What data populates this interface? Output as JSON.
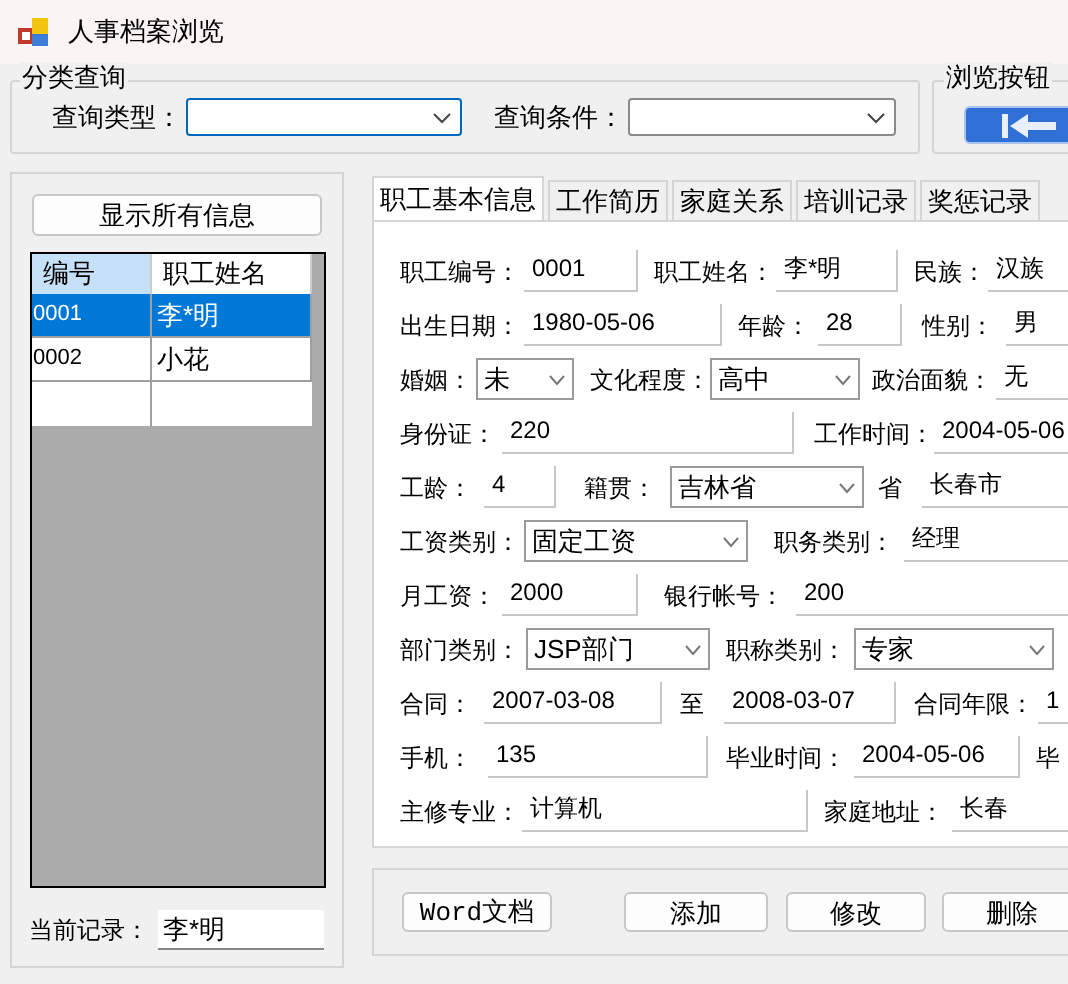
{
  "window": {
    "title": "人事档案浏览"
  },
  "query_group": {
    "title": "分类查询",
    "fields": [
      {
        "label": "查询类型：",
        "focused": true
      },
      {
        "label": "查询条件：",
        "focused": false
      }
    ]
  },
  "browse_group": {
    "title": "浏览按钮"
  },
  "show_all_button": "显示所有信息",
  "employee_grid": {
    "columns": [
      {
        "label": "编号",
        "highlighted": true
      },
      {
        "label": "职工姓名",
        "highlighted": false
      }
    ],
    "rows": [
      {
        "cells": [
          "0001",
          "李*明"
        ],
        "selected": true
      },
      {
        "cells": [
          "0002",
          "小花"
        ],
        "selected": false
      }
    ]
  },
  "current_record": {
    "label": "当前记录：",
    "value": "李*明"
  },
  "tabs": [
    {
      "label": "职工基本信息",
      "selected": true
    },
    {
      "label": "工作简历",
      "selected": false
    },
    {
      "label": "家庭关系",
      "selected": false
    },
    {
      "label": "培训记录",
      "selected": false
    },
    {
      "label": "奖惩记录",
      "selected": false
    }
  ],
  "form_rows": [
    [
      {
        "kind": "label",
        "text": "职工编号："
      },
      {
        "kind": "text",
        "value": "0001"
      },
      {
        "kind": "label",
        "text": "职工姓名："
      },
      {
        "kind": "text",
        "value": "李*明"
      },
      {
        "kind": "label",
        "text": "民族："
      },
      {
        "kind": "text",
        "value": "汉族"
      }
    ],
    [
      {
        "kind": "label",
        "text": "出生日期："
      },
      {
        "kind": "text",
        "value": "1980-05-06"
      },
      {
        "kind": "label",
        "text": "年龄："
      },
      {
        "kind": "text",
        "value": "28"
      },
      {
        "kind": "label",
        "text": "性别："
      },
      {
        "kind": "text",
        "value": "男"
      }
    ],
    [
      {
        "kind": "label",
        "text": "婚姻："
      },
      {
        "kind": "combo",
        "value": "未"
      },
      {
        "kind": "label",
        "text": "文化程度："
      },
      {
        "kind": "combo",
        "value": "高中"
      },
      {
        "kind": "label",
        "text": "政治面貌："
      },
      {
        "kind": "text",
        "value": "无"
      }
    ],
    [
      {
        "kind": "label",
        "text": "身份证："
      },
      {
        "kind": "text",
        "value": "220"
      },
      {
        "kind": "label",
        "text": "工作时间："
      },
      {
        "kind": "text",
        "value": "2004-05-06"
      }
    ],
    [
      {
        "kind": "label",
        "text": "工龄："
      },
      {
        "kind": "text",
        "value": "4"
      },
      {
        "kind": "label",
        "text": "籍贯："
      },
      {
        "kind": "combo",
        "value": "吉林省"
      },
      {
        "kind": "label",
        "text": "省"
      },
      {
        "kind": "text",
        "value": "长春市"
      }
    ],
    [
      {
        "kind": "label",
        "text": "工资类别："
      },
      {
        "kind": "combo",
        "value": "固定工资"
      },
      {
        "kind": "label",
        "text": "职务类别："
      },
      {
        "kind": "text",
        "value": "经理"
      }
    ],
    [
      {
        "kind": "label",
        "text": "月工资："
      },
      {
        "kind": "text",
        "value": "2000"
      },
      {
        "kind": "label",
        "text": "银行帐号："
      },
      {
        "kind": "text",
        "value": "200"
      }
    ],
    [
      {
        "kind": "label",
        "text": "部门类别："
      },
      {
        "kind": "combo",
        "value": "JSP部门"
      },
      {
        "kind": "label",
        "text": "职称类别："
      },
      {
        "kind": "combo",
        "value": "专家"
      }
    ],
    [
      {
        "kind": "label",
        "text": "合同："
      },
      {
        "kind": "text",
        "value": "2007-03-08"
      },
      {
        "kind": "label",
        "text": "至"
      },
      {
        "kind": "text",
        "value": "2008-03-07"
      },
      {
        "kind": "label",
        "text": "合同年限："
      },
      {
        "kind": "text",
        "value": "1"
      }
    ],
    [
      {
        "kind": "label",
        "text": "手机："
      },
      {
        "kind": "text",
        "value": "135"
      },
      {
        "kind": "label",
        "text": "毕业时间："
      },
      {
        "kind": "text",
        "value": "2004-05-06"
      },
      {
        "kind": "label",
        "text": "毕"
      }
    ],
    [
      {
        "kind": "label",
        "text": "主修专业："
      },
      {
        "kind": "text",
        "value": "计算机"
      },
      {
        "kind": "label",
        "text": "家庭地址："
      },
      {
        "kind": "text",
        "value": "长春"
      }
    ]
  ],
  "buttons": [
    "Word文档",
    "添加",
    "修改",
    "删除"
  ]
}
